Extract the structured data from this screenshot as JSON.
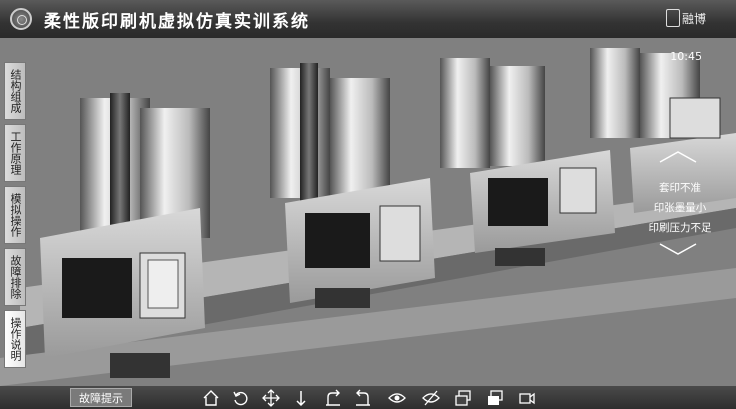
{
  "header": {
    "title": "柔性版印刷机虚拟仿真实训系统",
    "brand": "融博"
  },
  "clock": "10:45",
  "sidebar": {
    "tabs": [
      {
        "label": "结构组成"
      },
      {
        "label": "工作原理"
      },
      {
        "label": "模拟操作"
      },
      {
        "label": "故障排除"
      },
      {
        "label": "操作说明"
      }
    ]
  },
  "fault_list": {
    "items": [
      {
        "label": "套印不准"
      },
      {
        "label": "印张墨量小"
      },
      {
        "label": "印刷压力不足"
      }
    ]
  },
  "toolbar": {
    "hint_button": "故障提示",
    "tools": [
      {
        "icon": "home-icon"
      },
      {
        "icon": "rotate-icon"
      },
      {
        "icon": "pan-icon"
      },
      {
        "icon": "vertical-move-icon"
      },
      {
        "icon": "turn-right-icon"
      },
      {
        "icon": "turn-left-icon"
      },
      {
        "icon": "eye-icon"
      },
      {
        "icon": "eye-off-icon"
      },
      {
        "icon": "window-stack-icon"
      },
      {
        "icon": "window-icon"
      },
      {
        "icon": "video-camera-icon"
      }
    ]
  },
  "colors": {
    "title_bar": "#333333",
    "scene_bg": "#7d7d7d",
    "tab_bg": "#d0d0d0",
    "toolbar_bg": "#3a3a3a",
    "text_light": "#ffffff"
  }
}
